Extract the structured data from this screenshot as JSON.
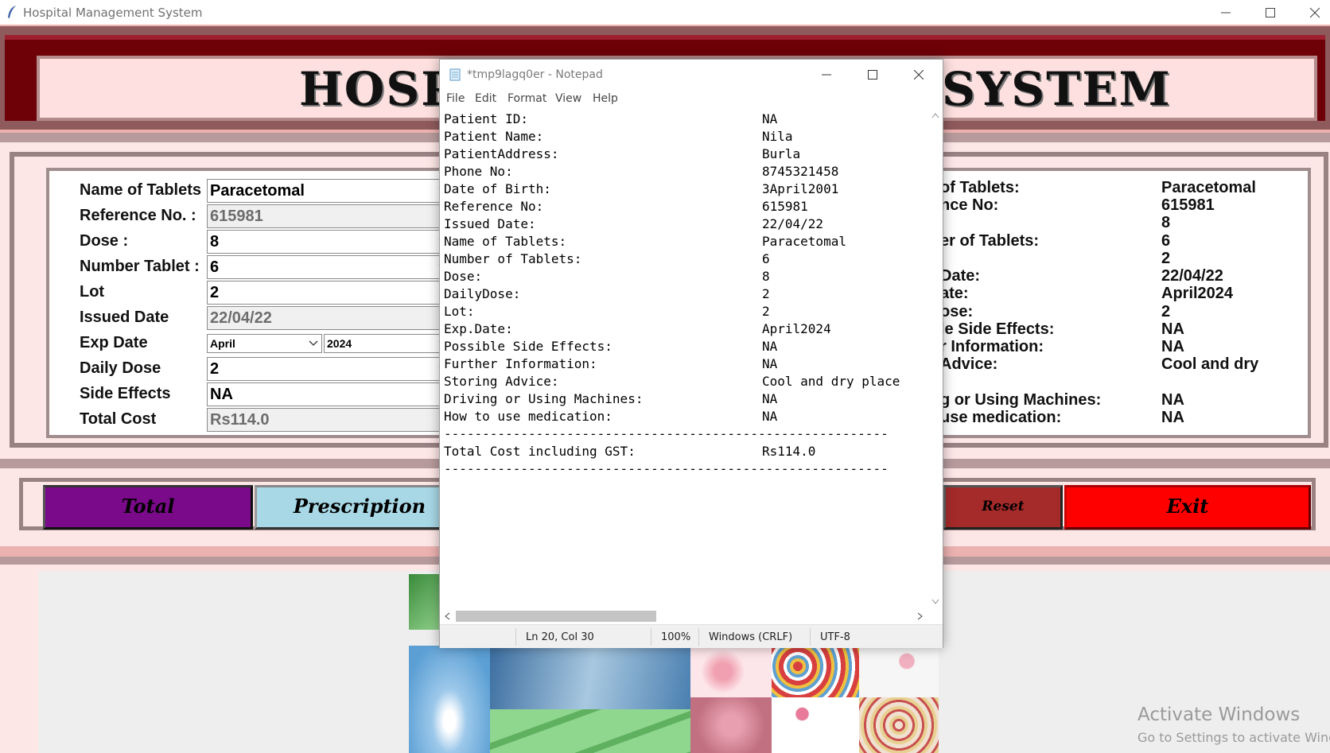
{
  "window": {
    "title": "Hospital Management System"
  },
  "banner": {
    "left_text": "HOSPI",
    "right_text": "SYSTEM"
  },
  "form": {
    "rows": [
      {
        "label": "Name of Tablets :",
        "value": "Paracetomal"
      },
      {
        "label": "Reference No. :",
        "value": "615981"
      },
      {
        "label": "Dose :",
        "value": "8"
      },
      {
        "label": "Number Tablet :",
        "value": "6"
      },
      {
        "label": "Lot",
        "value": "2"
      },
      {
        "label": "Issued Date",
        "value": "22/04/22"
      },
      {
        "label": "Exp Date",
        "month": "April",
        "year": "2024"
      },
      {
        "label": "Daily Dose",
        "value": "2"
      },
      {
        "label": "Side Effects",
        "value": "NA"
      },
      {
        "label": "Total Cost",
        "value": "Rs114.0"
      }
    ]
  },
  "right_panel": {
    "labels": [
      "of Tablets:",
      "nce No:",
      "er of Tablets:",
      "Date:",
      "ate:",
      "ose:",
      "le Side Effects:",
      "r Information:",
      "Advice:",
      "g or Using Machines:",
      "use medication:"
    ],
    "values": [
      "Paracetomal",
      "615981",
      "8",
      "6",
      "2",
      "22/04/22",
      "April2024",
      "2",
      "NA",
      "NA",
      "Cool and dry",
      "NA",
      "NA"
    ]
  },
  "buttons": {
    "total": "Total",
    "prescription": "Prescription",
    "reset": "Reset",
    "exit": "Exit"
  },
  "colors": {
    "total": "#7a0a8a",
    "prescription": "#a8d8e6",
    "reset": "#a52a2a",
    "exit": "#ff0000",
    "banner_dark": "#6e0008",
    "bg_pink": "#fde6e6"
  },
  "notepad": {
    "title": "*tmp9lagq0er - Notepad",
    "menu": [
      "File",
      "Edit",
      "Format",
      "View",
      "Help"
    ],
    "lines": [
      {
        "k": "Patient ID:",
        "v": "NA"
      },
      {
        "k": "Patient Name:",
        "v": "Nila"
      },
      {
        "k": "PatientAddress:",
        "v": "Burla"
      },
      {
        "k": "Phone No:",
        "v": "8745321458"
      },
      {
        "k": "Date of Birth:",
        "v": "3April2001"
      },
      {
        "k": "Reference No:",
        "v": "615981"
      },
      {
        "k": "Issued Date:",
        "v": "22/04/22"
      },
      {
        "k": "Name of Tablets:",
        "v": "Paracetomal"
      },
      {
        "k": "Number of Tablets:",
        "v": "6"
      },
      {
        "k": "Dose:",
        "v": "8"
      },
      {
        "k": "DailyDose:",
        "v": "2"
      },
      {
        "k": "Lot:",
        "v": "2"
      },
      {
        "k": "Exp.Date:",
        "v": "April2024"
      },
      {
        "k": "Possible Side Effects:",
        "v": "NA"
      },
      {
        "k": "Further Information:",
        "v": "NA"
      },
      {
        "k": "Storing Advice:",
        "v": "Cool and dry place"
      },
      {
        "k": "Driving or Using Machines:",
        "v": "NA"
      },
      {
        "k": "How to use medication:",
        "v": "NA"
      }
    ],
    "separator": "----------------------------------------------------------",
    "total_label": "Total Cost including GST:",
    "total_value": "Rs114.0",
    "status": {
      "position": "Ln 20, Col 30",
      "zoom": "100%",
      "eol": "Windows (CRLF)",
      "encoding": "UTF-8"
    }
  },
  "watermark": {
    "line1": "Activate Windows",
    "line2": "Go to Settings to activate Windows."
  }
}
